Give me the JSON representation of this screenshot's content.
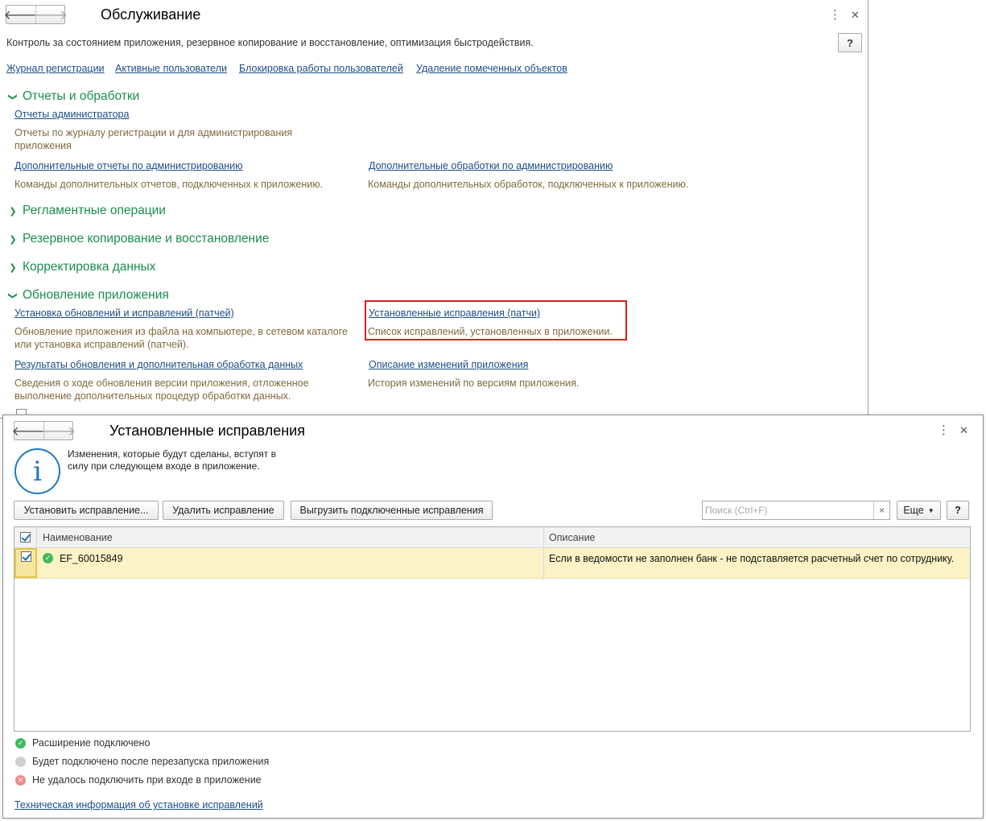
{
  "main_window": {
    "title": "Обслуживание",
    "subtitle": "Контроль за состоянием приложения, резервное копирование и восстановление, оптимизация быстродействия.",
    "more_icon": "more-vertical-icon",
    "help_label": "?",
    "top_links": [
      "Журнал регистрации",
      "Активные пользователи",
      "Блокировка работы пользователей",
      "Удаление помеченных объектов"
    ],
    "sections": {
      "reports": {
        "title": "Отчеты и обработки",
        "items": [
          {
            "link": "Отчеты администратора",
            "desc": "Отчеты по журналу регистрации и для администрирования приложения"
          },
          {
            "link": "Дополнительные отчеты по администрированию",
            "desc": "Команды дополнительных отчетов, подключенных к приложению."
          },
          {
            "link": "Дополнительные обработки по администрированию",
            "desc": "Команды дополнительных обработок, подключенных к приложению."
          }
        ]
      },
      "routine": {
        "title": "Регламентные операции"
      },
      "backup": {
        "title": "Резервное копирование и восстановление"
      },
      "correction": {
        "title": "Корректировка данных"
      },
      "update": {
        "title": "Обновление приложения",
        "items": [
          {
            "link": "Установка обновлений и исправлений (патчей)",
            "desc": "Обновление приложения из файла на компьютере, в сетевом каталоге или установка исправлений (патчей)."
          },
          {
            "link": "Установленные исправления (патчи)",
            "desc": "Список исправлений, установленных в приложении."
          },
          {
            "link": "Результаты обновления и дополнительная обработка данных",
            "desc": "Сведения о ходе обновления версии приложения, отложенное выполнение дополнительных процедур обработки данных."
          },
          {
            "link": "Описание изменений приложения",
            "desc": "История изменений по версиям приложения."
          }
        ]
      }
    }
  },
  "patch_window": {
    "title": "Установленные исправления",
    "info_text": "Изменения, которые будут сделаны, вступят в силу при следующем входе в приложение.",
    "buttons": {
      "install": "Установить исправление...",
      "delete": "Удалить исправление",
      "export": "Выгрузить подключенные исправления",
      "more": "Еще",
      "help": "?"
    },
    "search": {
      "placeholder": "Поиск (Ctrl+F)",
      "clear": "×"
    },
    "table": {
      "columns": [
        "Наименование",
        "Описание"
      ],
      "rows": [
        {
          "checked": true,
          "status": "green",
          "name": "EF_60015849",
          "description": "Если в ведомости не заполнен банк - не подставляется расчетный счет по сотруднику."
        }
      ]
    },
    "legend": [
      {
        "color": "green",
        "text": "Расширение подключено"
      },
      {
        "color": "grey",
        "text": "Будет подключено после перезапуска приложения"
      },
      {
        "color": "red",
        "text": "Не удалось подключить при входе в приложение"
      }
    ],
    "tech_link": "Техническая информация об установке исправлений"
  },
  "colors": {
    "section_green": "#1b8d4e",
    "link_blue": "#1d4d87",
    "desc_brown": "#7f6a3d",
    "highlight_red": "#e31d1d",
    "row_yellow": "#fbf2c6"
  }
}
